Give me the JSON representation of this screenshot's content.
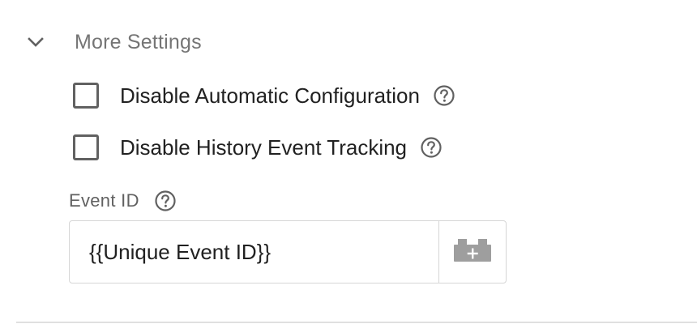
{
  "more_settings": {
    "title": "More Settings",
    "expanded": true,
    "chevron_icon": "chevron-down-icon"
  },
  "checkboxes": [
    {
      "label": "Disable Automatic Configuration",
      "checked": false
    },
    {
      "label": "Disable History Event Tracking",
      "checked": false
    }
  ],
  "event_id": {
    "label": "Event ID",
    "value": "{{Unique Event ID}}",
    "variable_icon": "lego-brick-add-icon"
  },
  "colors": {
    "header_text": "#757575",
    "icon": "#616161",
    "border": "#d6d6d6",
    "variable_icon": "#9e9e9e"
  }
}
